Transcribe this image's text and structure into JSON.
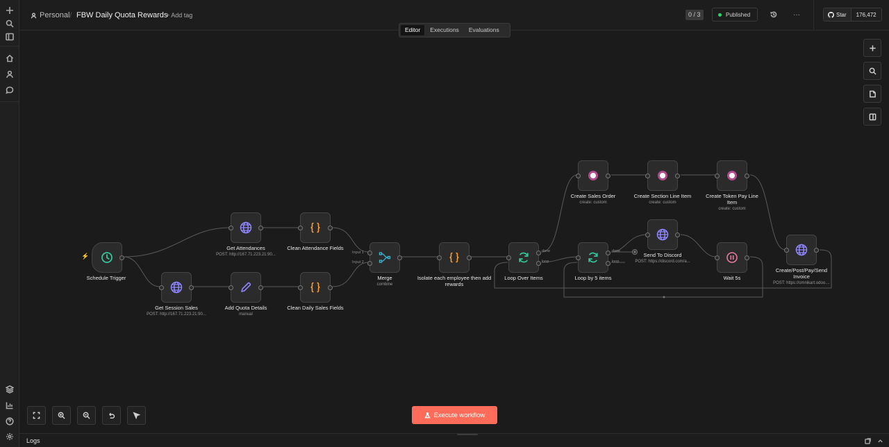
{
  "header": {
    "project": "Personal",
    "workflow_title": "FBW Daily Quota Rewards",
    "add_tag": "+ Add tag",
    "counter": "0 / 3",
    "status": "Published",
    "github_star": "Star",
    "github_count": "176,472"
  },
  "tabs": [
    {
      "label": "Editor",
      "active": true
    },
    {
      "label": "Executions",
      "active": false
    },
    {
      "label": "Evaluations",
      "active": false
    }
  ],
  "nodes": {
    "schedule_trigger": {
      "label": "Schedule Trigger",
      "icon": "clock-icon"
    },
    "get_attendances": {
      "label": "Get Attendances",
      "sub": "POST: http://167.71.223.21:90...",
      "icon": "globe-icon"
    },
    "clean_attendance": {
      "label": "Clean Attendance Fields",
      "icon": "code-braces-icon"
    },
    "get_session_sales": {
      "label": "Get Session Sales",
      "sub": "POST: http://167.71.223.21:90...",
      "icon": "globe-icon"
    },
    "add_quota": {
      "label": "Add Quota Details",
      "sub": "manual",
      "icon": "pencil-icon"
    },
    "clean_daily_sales": {
      "label": "Clean Daily Sales Fields",
      "icon": "code-braces-icon"
    },
    "merge": {
      "label": "Merge",
      "sub": "combine",
      "icon": "merge-icon",
      "input1": "Input 1",
      "input2": "Input 2"
    },
    "isolate": {
      "label": "Isolate each employee then add rewards",
      "icon": "code-braces-icon"
    },
    "loop_over": {
      "label": "Loop Over Items",
      "icon": "refresh-icon",
      "done": "done",
      "loop": "loop"
    },
    "loop_by5": {
      "label": "Loop by 5 items",
      "icon": "refresh-icon",
      "done": "done",
      "loop": "loop"
    },
    "create_sales_order": {
      "label": "Create Sales Order",
      "sub": "create: custom",
      "icon": "odoo-icon"
    },
    "create_section_line": {
      "label": "Create Section Line Item",
      "sub": "create: custom",
      "icon": "odoo-icon"
    },
    "create_token_pay": {
      "label": "Create Token Pay Line Item",
      "sub": "create: custom",
      "icon": "odoo-icon"
    },
    "send_discord": {
      "label": "Send To Discord",
      "sub": "POST: https://discord.com/a...",
      "icon": "globe-icon"
    },
    "wait": {
      "label": "Wait 5s",
      "icon": "pause-icon"
    },
    "create_invoice": {
      "label": "Create/Post/Pay/Send Invoice",
      "sub": "POST: https://omnikart.odoo....",
      "icon": "globe-icon"
    }
  },
  "execute_label": "Execute workflow",
  "logs_label": "Logs",
  "colors": {
    "accent": "#ff6d5a",
    "published_dot": "#2fcf6a",
    "globe": "#8f86ff",
    "code": "#ff9b2f",
    "clock": "#35c59a",
    "merge": "#3ab7d8",
    "odoo": "#b04a8c"
  }
}
